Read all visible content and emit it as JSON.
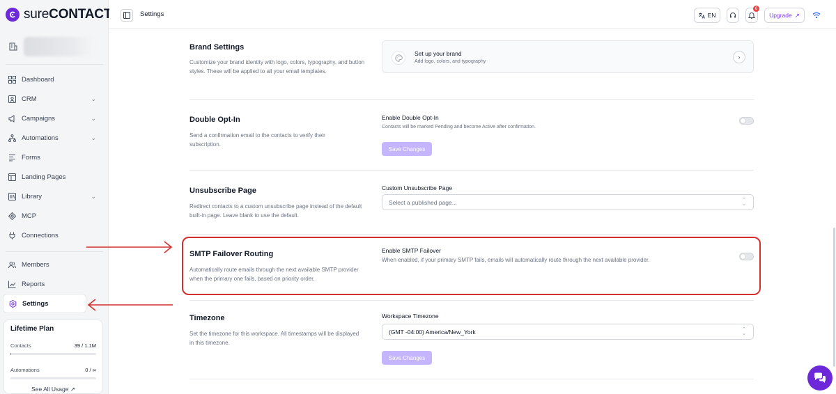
{
  "app": {
    "brand_light": "sure",
    "brand_bold": "CONTACT",
    "accent_color": "#6d28d9",
    "highlight_color": "#d32f2f"
  },
  "sidebar": {
    "items": [
      {
        "label": "Dashboard",
        "icon": "dashboard-icon",
        "chevron": false
      },
      {
        "label": "CRM",
        "icon": "contact-card-icon",
        "chevron": true
      },
      {
        "label": "Campaigns",
        "icon": "megaphone-icon",
        "chevron": true
      },
      {
        "label": "Automations",
        "icon": "workflow-icon",
        "chevron": true
      },
      {
        "label": "Forms",
        "icon": "form-icon",
        "chevron": false
      },
      {
        "label": "Landing Pages",
        "icon": "layout-icon",
        "chevron": false
      },
      {
        "label": "Library",
        "icon": "library-icon",
        "chevron": true
      },
      {
        "label": "MCP",
        "icon": "mcp-icon",
        "chevron": false
      }
    ],
    "connections_label": "Connections",
    "secondary_items": [
      {
        "label": "Members",
        "icon": "users-icon"
      },
      {
        "label": "Reports",
        "icon": "chart-icon"
      },
      {
        "label": "Settings",
        "icon": "gear-icon",
        "active": true
      }
    ],
    "plan": {
      "title": "Lifetime Plan",
      "contacts_label": "Contacts",
      "contacts_value": "39 / 1.1M",
      "contacts_fraction": 0.01,
      "automations_label": "Automations",
      "automations_value": "0 / ∞",
      "automations_fraction": 0.0,
      "link_label": "See All Usage",
      "link_arrow": "↗"
    }
  },
  "header": {
    "title": "Settings",
    "language": "EN",
    "notification_count": "6",
    "upgrade_label": "Upgrade",
    "upgrade_arrow": "↗"
  },
  "sections": {
    "brand": {
      "title": "Brand Settings",
      "description": "Customize your brand identity with logo, colors, typography, and button styles. These will be applied to all your email templates.",
      "card_title": "Set up your brand",
      "card_subtitle": "Add logo, colors, and typography",
      "arrow": "›"
    },
    "double_opt_in": {
      "title": "Double Opt-In",
      "description": "Send a confirmation email to the contacts to verify their subscription.",
      "field_label": "Enable Double Opt-In",
      "field_help": "Contacts will be marked Pending and become Active after confirmation.",
      "enabled": false,
      "save_label": "Save Changes"
    },
    "unsubscribe": {
      "title": "Unsubscribe Page",
      "description": "Redirect contacts to a custom unsubscribe page instead of the default built-in page. Leave blank to use the default.",
      "field_label": "Custom Unsubscribe Page",
      "placeholder": "Select a published page..."
    },
    "smtp": {
      "title": "SMTP Failover Routing",
      "description": "Automatically route emails through the next available SMTP provider when the primary one fails, based on priority order.",
      "field_label": "Enable SMTP Failover",
      "field_help": "When enabled, if your primary SMTP fails, emails will automatically route through the next available provider.",
      "enabled": false
    },
    "timezone": {
      "title": "Timezone",
      "description": "Set the timezone for this workspace. All timestamps will be displayed in this timezone.",
      "field_label": "Workspace Timezone",
      "value": "(GMT -04:00) America/New_York",
      "save_label": "Save Changes"
    }
  },
  "caret_up": "⌃",
  "caret_down": "⌄"
}
